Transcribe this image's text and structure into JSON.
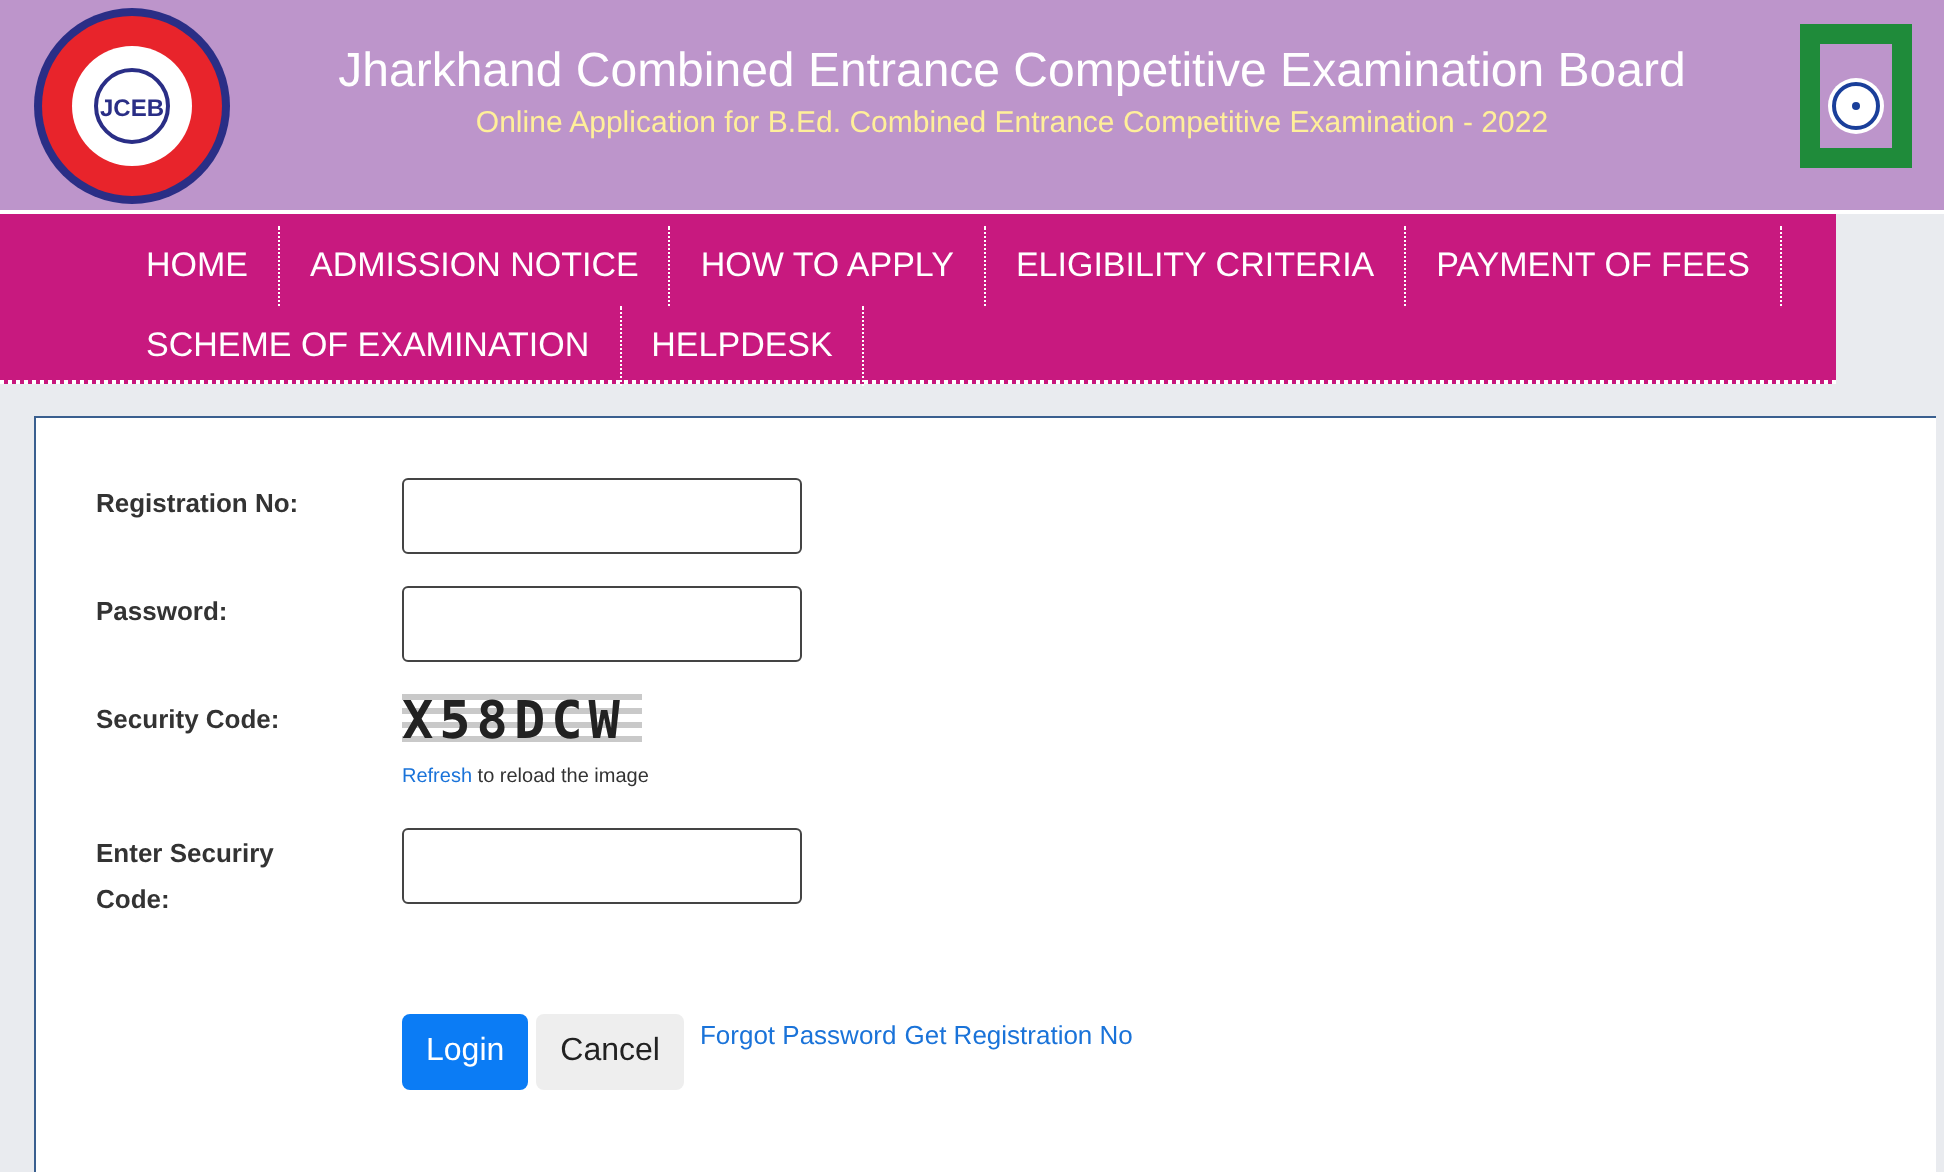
{
  "header": {
    "logo_text": "JCEB",
    "title": "Jharkhand Combined Entrance Competitive Examination Board",
    "subtitle": "Online Application for B.Ed. Combined Entrance Competitive Examination - 2022"
  },
  "nav": [
    {
      "label": "HOME"
    },
    {
      "label": "ADMISSION NOTICE"
    },
    {
      "label": "HOW TO APPLY"
    },
    {
      "label": "ELIGIBILITY CRITERIA"
    },
    {
      "label": "PAYMENT OF FEES"
    },
    {
      "label": "SCHEME OF EXAMINATION"
    },
    {
      "label": "HELPDESK"
    }
  ],
  "form": {
    "fields": [
      {
        "kind": "input",
        "label": "Registration No:"
      },
      {
        "kind": "input",
        "label": "Password:"
      },
      {
        "kind": "captcha",
        "label": "Security Code:",
        "code": "X58DCW",
        "refresh_link": "Refresh",
        "refresh_text": "to reload the image"
      },
      {
        "kind": "input",
        "label": "Enter Securiry Code:"
      }
    ],
    "buttons": [
      {
        "kind": "primary",
        "label": "Login"
      },
      {
        "kind": "secondary",
        "label": "Cancel"
      }
    ],
    "links": [
      "Forgot Password",
      "Get Registration No"
    ]
  }
}
